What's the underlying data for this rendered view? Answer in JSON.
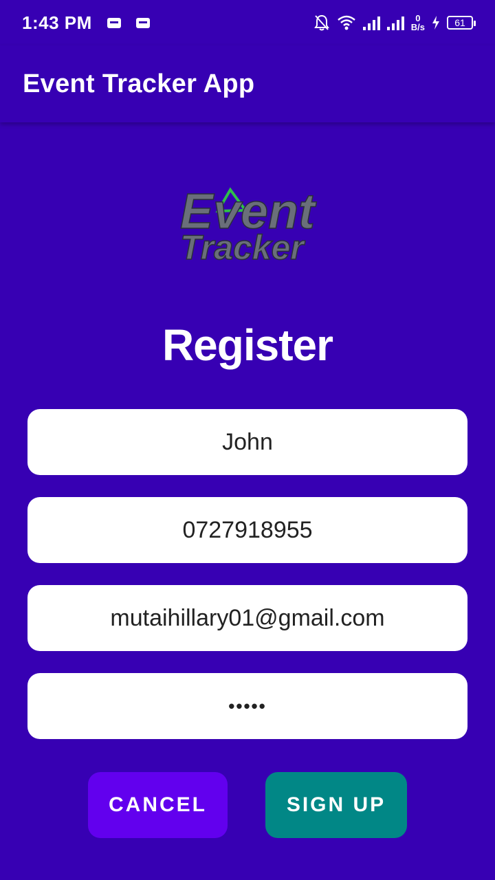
{
  "status": {
    "time": "1:43 PM",
    "net_speed": "0",
    "net_unit": "B/s",
    "battery": "61"
  },
  "app_bar": {
    "title": "Event Tracker App"
  },
  "logo": {
    "line1": "Event",
    "line2": "Tracker"
  },
  "form": {
    "title": "Register",
    "name": "John",
    "phone": "0727918955",
    "email": "mutaihillary01@gmail.com",
    "password_mask": "•••••"
  },
  "buttons": {
    "cancel": "CANCEL",
    "signup": "SIGN UP"
  },
  "colors": {
    "background": "#3700b3",
    "cancel": "#6200ee",
    "signup": "#018786"
  }
}
